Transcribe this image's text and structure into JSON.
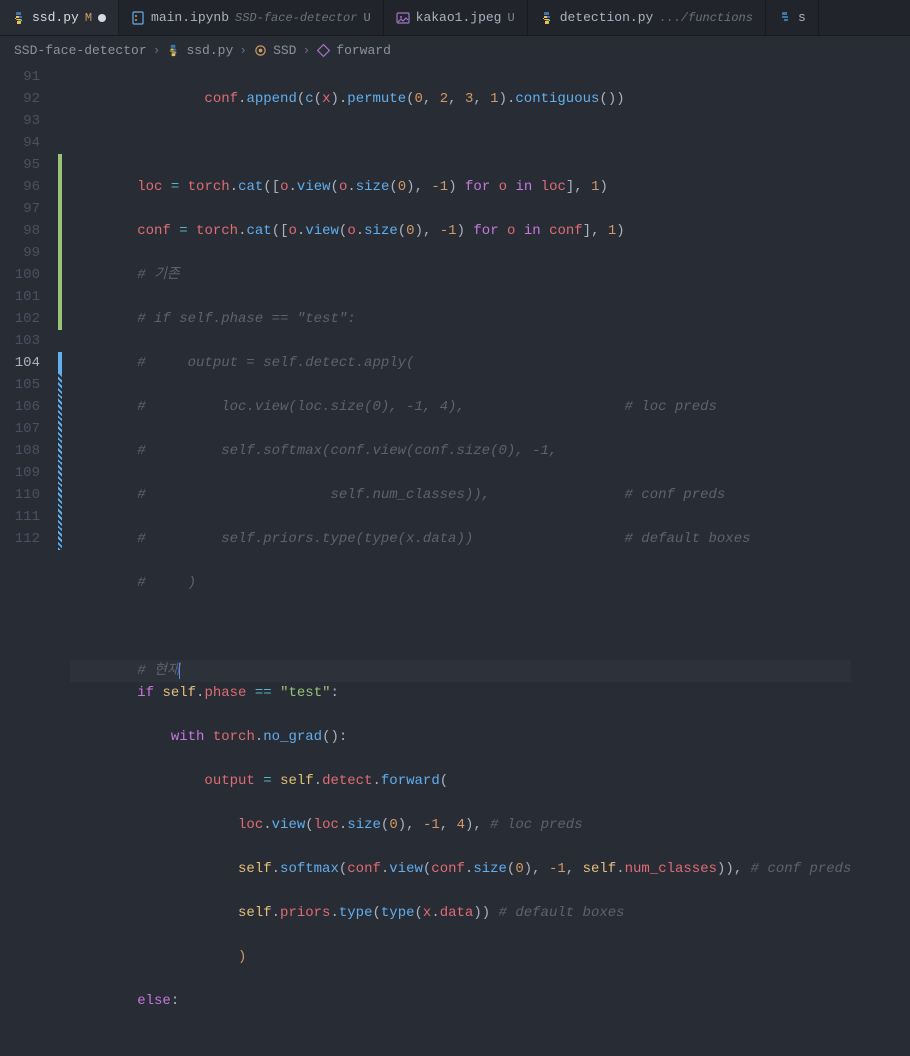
{
  "tabs": [
    {
      "name": "ssd.py",
      "badge": "M",
      "active": true,
      "modified": true
    },
    {
      "name": "main.ipynb",
      "suffix": "SSD-face-detector",
      "badge": "U"
    },
    {
      "name": "kakao1.jpeg",
      "badge": "U"
    },
    {
      "name": "detection.py",
      "suffix": ".../functions"
    },
    {
      "name": "s"
    }
  ],
  "breadcrumb": {
    "folder": "SSD-face-detector",
    "file": "ssd.py",
    "class": "SSD",
    "method": "forward"
  },
  "lines": {
    "n91": "91",
    "n92": "92",
    "n93": "93",
    "n94": "94",
    "n95": "95",
    "n96": "96",
    "n97": "97",
    "n98": "98",
    "n99": "99",
    "n100": "100",
    "n101": "101",
    "n102": "102",
    "n103": "103",
    "n104": "104",
    "n105": "105",
    "n106": "106",
    "n107": "107",
    "n108": "108",
    "n109": "109",
    "n110": "110",
    "n111": "111",
    "n112": "112"
  },
  "code": {
    "l95": "        # 기존",
    "l96": "        # if self.phase == \"test\":",
    "l97": "        #     output = self.detect.apply(",
    "l98": "        #         loc.view(loc.size(0), -1, 4),                   # loc preds",
    "l99": "        #         self.softmax(conf.view(conf.size(0), -1,",
    "l100": "        #                      self.num_classes)),                # conf preds",
    "l101": "        #         self.priors.type(type(x.data))                  # default boxes",
    "l102": "        #     )",
    "l104": "        # 현재",
    "l108c": " # loc preds",
    "l109c": " # conf preds",
    "l110c": " # default boxes"
  },
  "tok": {
    "conf": "conf",
    "append": "append",
    "c": "c",
    "x": "x",
    "permute": "permute",
    "contiguous": "contiguous",
    "loc": "loc",
    "torch": "torch",
    "cat": "cat",
    "o": "o",
    "view": "view",
    "size": "size",
    "for": "for",
    "in": "in",
    "if": "if",
    "self": "self",
    "phase": "phase",
    "test": "\"test\"",
    "with": "with",
    "no_grad": "no_grad",
    "output": "output",
    "detect": "detect",
    "forward": "forward",
    "softmax": "softmax",
    "num_classes": "num_classes",
    "priors": "priors",
    "type": "type",
    "data": "data",
    "else": "else",
    "n0": "0",
    "n1": "1",
    "n2": "2",
    "n3": "3",
    "n4": "4",
    "nm1": "-1",
    "eq": "==",
    "dot": ".",
    "cm": ",",
    "op": "(",
    "cp": ")",
    "ob": "[",
    "cb": "]",
    "col": ":",
    "asn": "="
  }
}
